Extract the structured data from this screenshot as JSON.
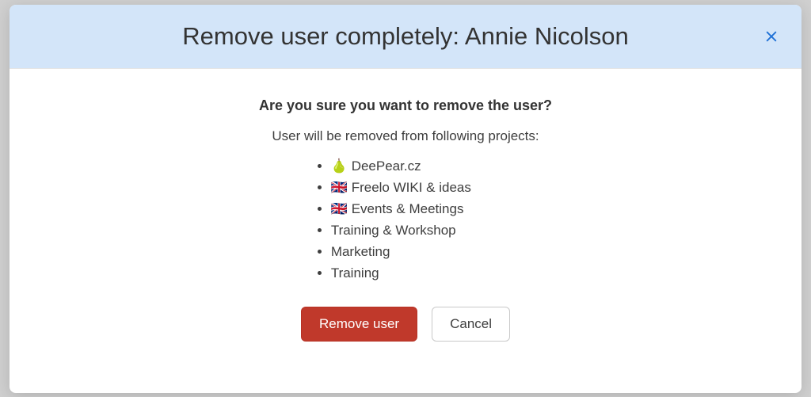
{
  "modal": {
    "title": "Remove user completely: Annie Nicolson",
    "confirm_question": "Are you sure you want to remove the user?",
    "remove_note": "User will be removed from following projects:",
    "projects": [
      "🍐 DeePear.cz",
      "🇬🇧 Freelo WIKI & ideas",
      "🇬🇧 Events & Meetings",
      "Training & Workshop",
      "Marketing",
      "Training"
    ],
    "buttons": {
      "remove": "Remove user",
      "cancel": "Cancel"
    }
  }
}
